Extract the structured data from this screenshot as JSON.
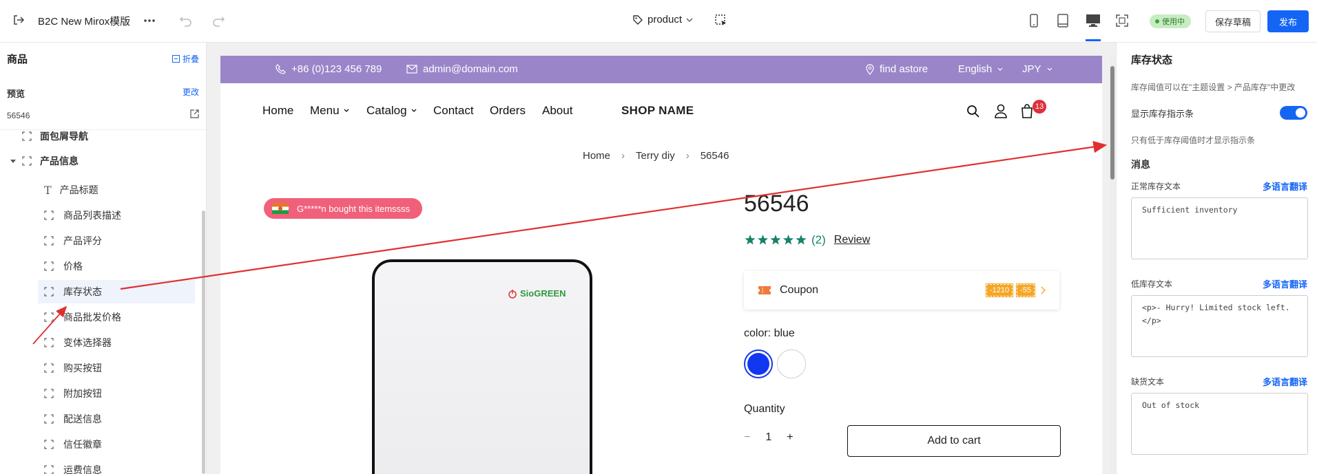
{
  "app": {
    "title": "B2C New Mirox模版",
    "template_selector": "product",
    "status_badge": "使用中",
    "save_draft": "保存草稿",
    "publish": "发布"
  },
  "left_panel": {
    "title": "商品",
    "collapse": "折叠",
    "preview_label": "预览",
    "change": "更改",
    "preview_value": "56546",
    "items": [
      {
        "label": "面包屑导航"
      },
      {
        "label": "产品信息"
      },
      {
        "label": "产品标题"
      },
      {
        "label": "商品列表描述"
      },
      {
        "label": "产品评分"
      },
      {
        "label": "价格"
      },
      {
        "label": "库存状态"
      },
      {
        "label": "商品批发价格"
      },
      {
        "label": "变体选择器"
      },
      {
        "label": "购买按钮"
      },
      {
        "label": "附加按钮"
      },
      {
        "label": "配送信息"
      },
      {
        "label": "信任徽章"
      },
      {
        "label": "运费信息"
      }
    ]
  },
  "store": {
    "promo": {
      "phone": "+86 (0)123 456 789",
      "email": "admin@domain.com",
      "find_store": "find astore",
      "language": "English",
      "currency": "JPY"
    },
    "nav": {
      "items": [
        "Home",
        "Menu",
        "Catalog",
        "Contact",
        "Orders",
        "About"
      ],
      "shop_name": "SHOP NAME",
      "cart_count": "13"
    },
    "breadcrumb": [
      "Home",
      "Terry diy",
      "56546"
    ],
    "sep": "›",
    "bought_text": "G*****n bought this itemssss",
    "product_brand": "SioGREEN",
    "product": {
      "title": "56546",
      "rating_stars": 5,
      "rating_count": "(2)",
      "review": "Review",
      "coupon_label": "Coupon",
      "coupon_tags": [
        "-1210",
        "-55"
      ],
      "color_label": "color:",
      "color_value": "blue",
      "swatches": [
        "#1237f0",
        "#ffffff"
      ],
      "quantity_label": "Quantity",
      "qty_minus": "−",
      "qty_value": "1",
      "qty_plus": "+",
      "add_to_cart": "Add to cart"
    }
  },
  "right_panel": {
    "title": "库存状态",
    "hint": "库存阈值可以在\"主题设置 > 产品库存\"中更改",
    "show_indicator": "显示库存指示条",
    "show_indicator_on": true,
    "only_below": "只有低于库存阈值时才显示指示条",
    "messages_title": "消息",
    "normal_label": "正常库存文本",
    "normal_value": "Sufficient inventory",
    "low_label": "低库存文本",
    "low_value": "<p>- Hurry! Limited stock left.</p>",
    "out_label": "缺货文本",
    "out_value": "Out of stock",
    "translate": "多语言翻译"
  },
  "colors": {
    "accent": "#1565f5",
    "promo_bar": "#9a85c9",
    "badge_red": "#e0303a",
    "rating_green": "#17826b",
    "annotation_arrow": "#e02f2f"
  }
}
